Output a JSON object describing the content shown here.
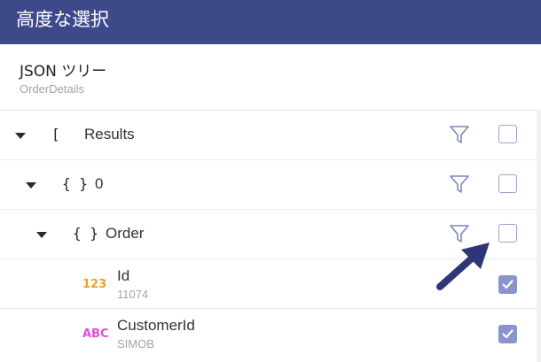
{
  "titlebar": {
    "title": "高度な選択"
  },
  "info": {
    "title": "JSON ツリー",
    "subtitle": "OrderDetails"
  },
  "rows": [
    {
      "bracket": "[",
      "label": "Results",
      "checked": false
    },
    {
      "bracket": "{ }",
      "label": "0",
      "checked": false
    },
    {
      "bracket": "{ }",
      "label": "Order",
      "checked": false
    }
  ],
  "fields": [
    {
      "type_badge": "123",
      "type_color": "#f0a020",
      "name": "Id",
      "value": "11074",
      "checked": true
    },
    {
      "type_badge": "ABC",
      "type_color": "#e64ad8",
      "name": "CustomerId",
      "value": "SIMOB",
      "checked": true
    }
  ],
  "icons": {
    "caret": "caret-down-icon",
    "filter": "filter-icon",
    "check": "check-icon",
    "pointer": "pointer-arrow-icon"
  },
  "colors": {
    "header": "#3e4989",
    "accent": "#8a93cc",
    "filter": "#7b86c2"
  }
}
